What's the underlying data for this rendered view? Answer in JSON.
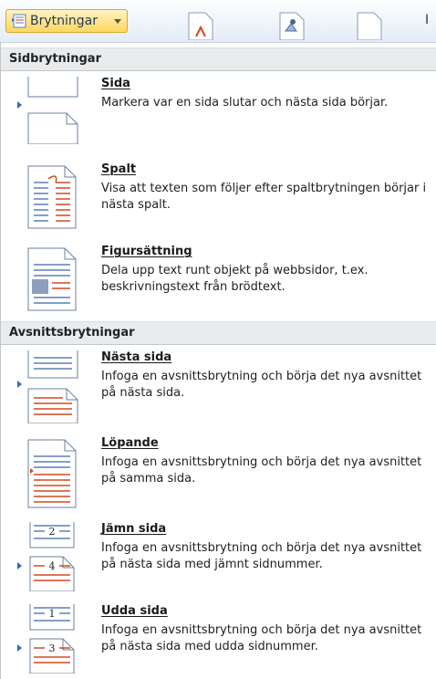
{
  "toolbar": {
    "breaks_label": "Brytningar",
    "truncated_text": "I"
  },
  "sections": [
    {
      "heading": "Sidbrytningar"
    },
    {
      "heading": "Avsnittsbrytningar"
    }
  ],
  "items": [
    {
      "title": "Sida",
      "desc": "Markera var en sida slutar och nästa sida börjar."
    },
    {
      "title": "Spalt",
      "desc": "Visa att texten som följer efter spaltbrytningen börjar i nästa spalt."
    },
    {
      "title": "Figursättning",
      "desc": "Dela upp text runt objekt på webbsidor, t.ex. beskrivningstext från brödtext."
    },
    {
      "title": "Nästa sida",
      "desc": "Infoga en avsnittsbrytning och börja det nya avsnittet på nästa sida."
    },
    {
      "title": "Löpande",
      "desc": "Infoga en avsnittsbrytning och börja det nya avsnittet på samma sida."
    },
    {
      "title": "Jämn sida",
      "desc": "Infoga en avsnittsbrytning och börja det nya avsnittet på nästa sida med jämnt sidnummer."
    },
    {
      "title": "Udda sida",
      "desc": "Infoga en avsnittsbrytning och börja det nya avsnittet på nästa sida med udda sidnummer."
    }
  ],
  "thumb_numbers": {
    "even_top": "2",
    "even_bottom": "4",
    "odd_top": "1",
    "odd_bottom": "3"
  },
  "colors": {
    "accent_red": "#d04a1e",
    "line_blue": "#5b7fb5",
    "highlight": "#ffd65e"
  }
}
